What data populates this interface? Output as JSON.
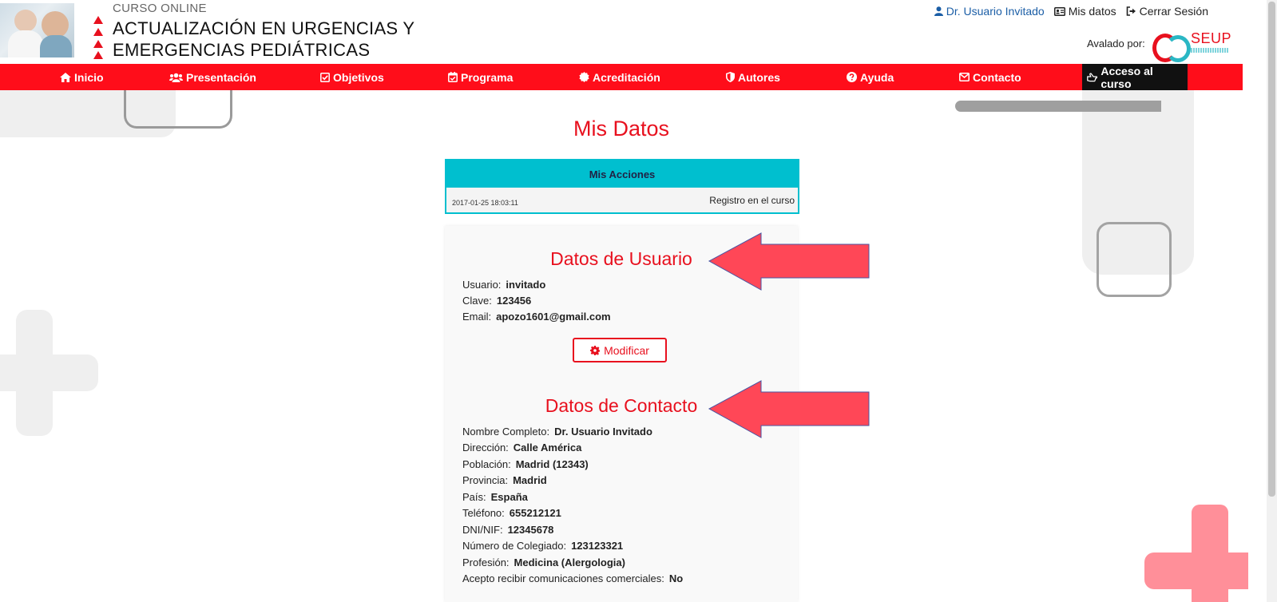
{
  "header": {
    "course_small": "CURSO ONLINE",
    "course_title": "ACTUALIZACIÓN EN URGENCIAS Y\nEMERGENCIAS PEDIÁTRICAS",
    "user_link": "Dr. Usuario Invitado",
    "mis_datos_link": "Mis datos",
    "logout_link": "Cerrar Sesión",
    "avalado": "Avalado por:",
    "seup_logo_text": "SEUP"
  },
  "nav": {
    "items": [
      {
        "label": "Inicio",
        "icon": "home-icon"
      },
      {
        "label": "Presentación",
        "icon": "users-icon"
      },
      {
        "label": "Objetivos",
        "icon": "checkbox-icon"
      },
      {
        "label": "Programa",
        "icon": "calendar-check-icon"
      },
      {
        "label": "Acreditación",
        "icon": "certificate-icon"
      },
      {
        "label": "Autores",
        "icon": "shield-icon"
      },
      {
        "label": "Ayuda",
        "icon": "question-circle-icon"
      },
      {
        "label": "Contacto",
        "icon": "envelope-icon"
      },
      {
        "label": "Acceso al curso",
        "icon": "hand-pointer-icon"
      }
    ]
  },
  "main": {
    "page_title": "Mis Datos",
    "acciones": {
      "header": "Mis Acciones",
      "rows": [
        {
          "date": "2017-01-25 18:03:11",
          "text": "Registro en el curso"
        }
      ]
    },
    "usuario": {
      "title": "Datos de Usuario",
      "fields": [
        {
          "label": "Usuario:",
          "value": "invitado"
        },
        {
          "label": "Clave:",
          "value": "123456"
        },
        {
          "label": "Email:",
          "value": "apozo1601@gmail.com"
        }
      ],
      "modify_button": "Modificar"
    },
    "contacto": {
      "title": "Datos de Contacto",
      "fields": [
        {
          "label": "Nombre Completo:",
          "value": "Dr. Usuario Invitado"
        },
        {
          "label": "Dirección:",
          "value": "Calle América"
        },
        {
          "label": "Población:",
          "value": "Madrid (12343)"
        },
        {
          "label": "Provincia:",
          "value": "Madrid"
        },
        {
          "label": "País:",
          "value": "España"
        },
        {
          "label": "Teléfono:",
          "value": "655212121"
        },
        {
          "label": "DNI/NIF:",
          "value": "12345678"
        },
        {
          "label": "Número de Colegiado:",
          "value": "123123321"
        },
        {
          "label": "Profesión:",
          "value": "Medicina (Alergologia)"
        },
        {
          "label": "Acepto recibir comunicaciones comerciales:",
          "value": "No"
        }
      ]
    }
  },
  "colors": {
    "brand_red": "#ff0d1a",
    "title_red": "#e8101e",
    "teal": "#00bfcf",
    "arrow_fill": "#ff4757"
  }
}
